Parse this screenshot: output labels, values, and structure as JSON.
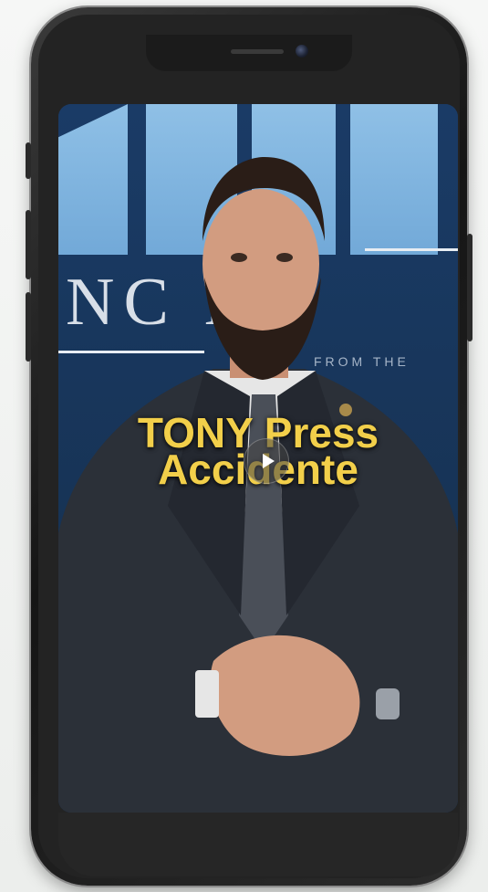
{
  "video": {
    "caption_line1": "TONY Press",
    "caption_line2": "Accidente",
    "play_label": "Play"
  },
  "backdrop": {
    "banner_letters": "NC FA",
    "banner_subtext": "FROM THE"
  },
  "colors": {
    "caption": "#f2cf4a",
    "backdrop_blue": "#1a3b66",
    "phone_body": "#1b1b1b"
  },
  "icons": {
    "play": "play-icon"
  }
}
